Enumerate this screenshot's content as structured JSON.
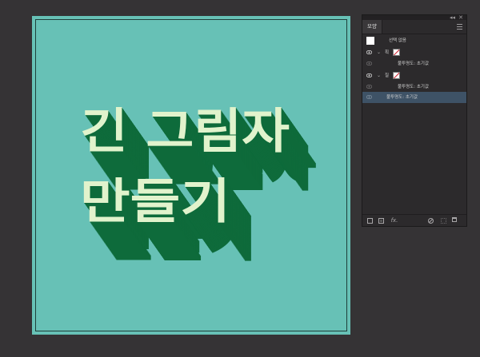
{
  "artwork": {
    "line1": "긴 그림자",
    "line2": "만들기",
    "colors": {
      "background": "#67c1b6",
      "text": "#e1f3cc",
      "shadow": "#0e6b3b",
      "frame": "#1f3f3a"
    }
  },
  "panel": {
    "tab_label": "모양",
    "collapse_icon": "collapse-icon",
    "close_icon": "close-icon",
    "menu_icon": "panel-menu-icon",
    "object_label": "선택 없음",
    "rows": [
      {
        "type": "stroke",
        "label": "획",
        "swatch_icon": "no-color-swatch"
      },
      {
        "type": "opacity",
        "label": "불투명도: 초기값"
      },
      {
        "type": "fill",
        "label": "칠",
        "swatch_icon": "no-color-swatch"
      },
      {
        "type": "opacity",
        "label": "불투명도: 초기값"
      },
      {
        "type": "opacity",
        "label": "불투명도: 초기값",
        "selected": true
      }
    ],
    "footer_icons": [
      "add-stroke-icon",
      "add-fill-icon",
      "fx-icon",
      "clear-appearance-icon",
      "duplicate-item-icon",
      "delete-item-icon"
    ],
    "fx_label": "fx."
  }
}
